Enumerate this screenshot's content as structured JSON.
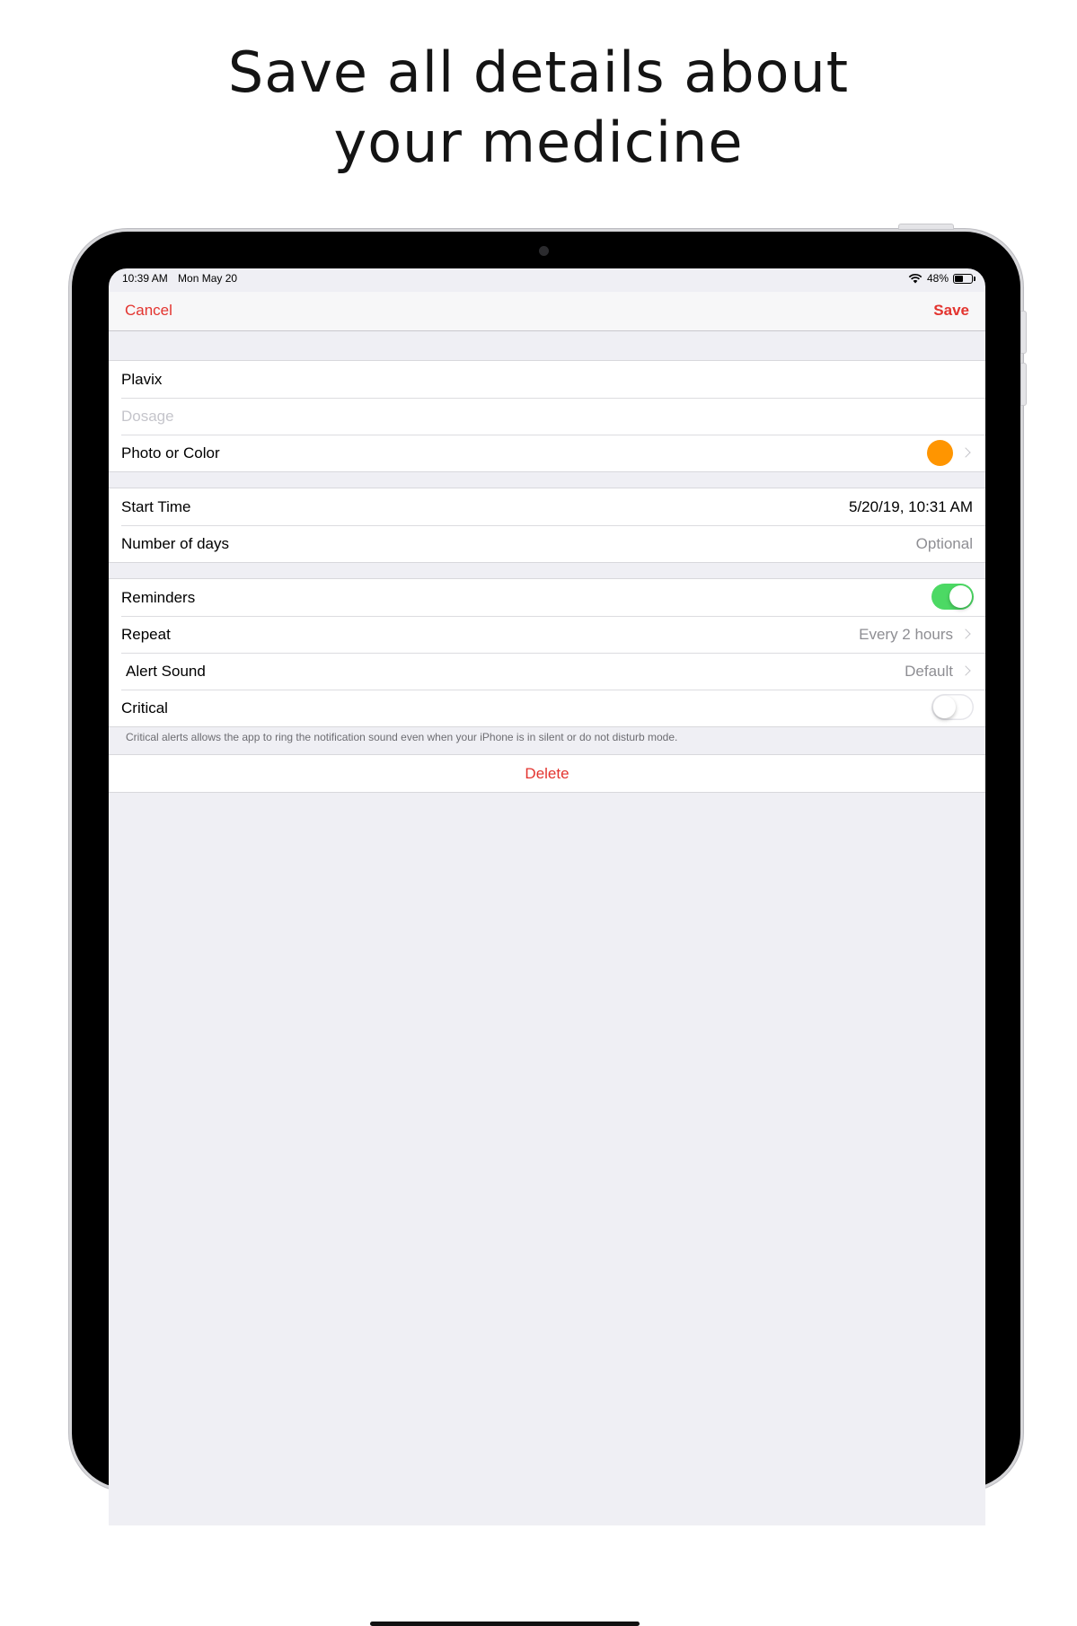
{
  "headline": {
    "line1": "Save all details about",
    "line2": "your medicine"
  },
  "status_bar": {
    "time": "10:39 AM",
    "date": "Mon May 20",
    "battery_percent": "48%",
    "battery_level": 0.48
  },
  "nav": {
    "cancel_label": "Cancel",
    "save_label": "Save"
  },
  "medicine": {
    "name": "Plavix",
    "dosage_placeholder": "Dosage",
    "photo_label": "Photo or Color",
    "color": "#ff9500"
  },
  "schedule": {
    "start_time_label": "Start Time",
    "start_time_value": "5/20/19, 10:31 AM",
    "days_label": "Number of days",
    "days_placeholder": "Optional"
  },
  "alerts": {
    "reminders_label": "Reminders",
    "reminders_on": true,
    "repeat_label": "Repeat",
    "repeat_value": "Every 2 hours",
    "sound_label": "Alert Sound",
    "sound_value": "Default",
    "critical_label": "Critical",
    "critical_on": false,
    "footnote": "Critical alerts allows the app to ring the notification sound even when your iPhone is in silent or do not disturb mode."
  },
  "delete_label": "Delete",
  "colors": {
    "accent_red": "#e3342f",
    "toggle_green": "#4cd964",
    "grouped_bg": "#efeff4"
  }
}
